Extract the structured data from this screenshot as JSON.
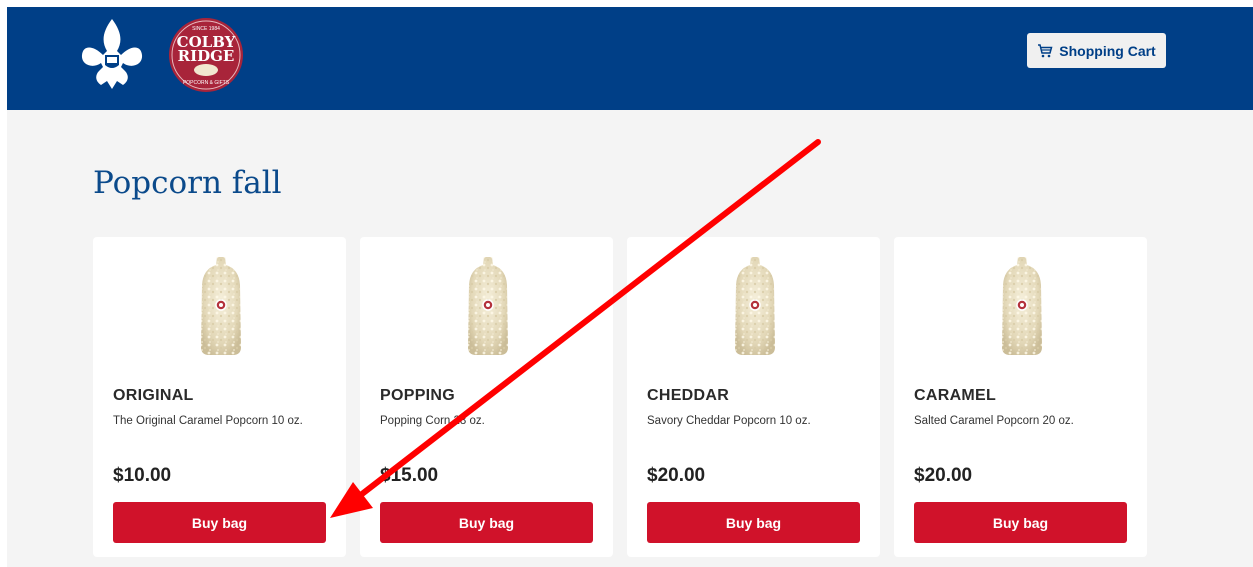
{
  "header": {
    "logos": {
      "bsa_logo_icon": "fleur-de-lis-logo",
      "colby_ridge": {
        "top": "SINCE 1984",
        "line1": "COLBY",
        "line2": "RIDGE",
        "bottom": "POPCORN & GIFTS"
      }
    },
    "cart": {
      "label": "Shopping Cart",
      "icon": "shopping-cart-icon"
    }
  },
  "page": {
    "title": "Popcorn fall"
  },
  "products": [
    {
      "name": "ORIGINAL",
      "description": "The Original Caramel Popcorn 10 oz.",
      "price": "$10.00",
      "button": "Buy bag"
    },
    {
      "name": "POPPING",
      "description": "Popping Corn 28 oz.",
      "price": "$15.00",
      "button": "Buy bag"
    },
    {
      "name": "CHEDDAR",
      "description": "Savory Cheddar Popcorn 10 oz.",
      "price": "$20.00",
      "button": "Buy bag"
    },
    {
      "name": "CARAMEL",
      "description": "Salted Caramel Popcorn 20 oz.",
      "price": "$20.00",
      "button": "Buy bag"
    }
  ],
  "colors": {
    "header": "#003f87",
    "accent": "#d0122a",
    "title": "#0b4a8b",
    "annotation_arrow": "#ff0000"
  }
}
